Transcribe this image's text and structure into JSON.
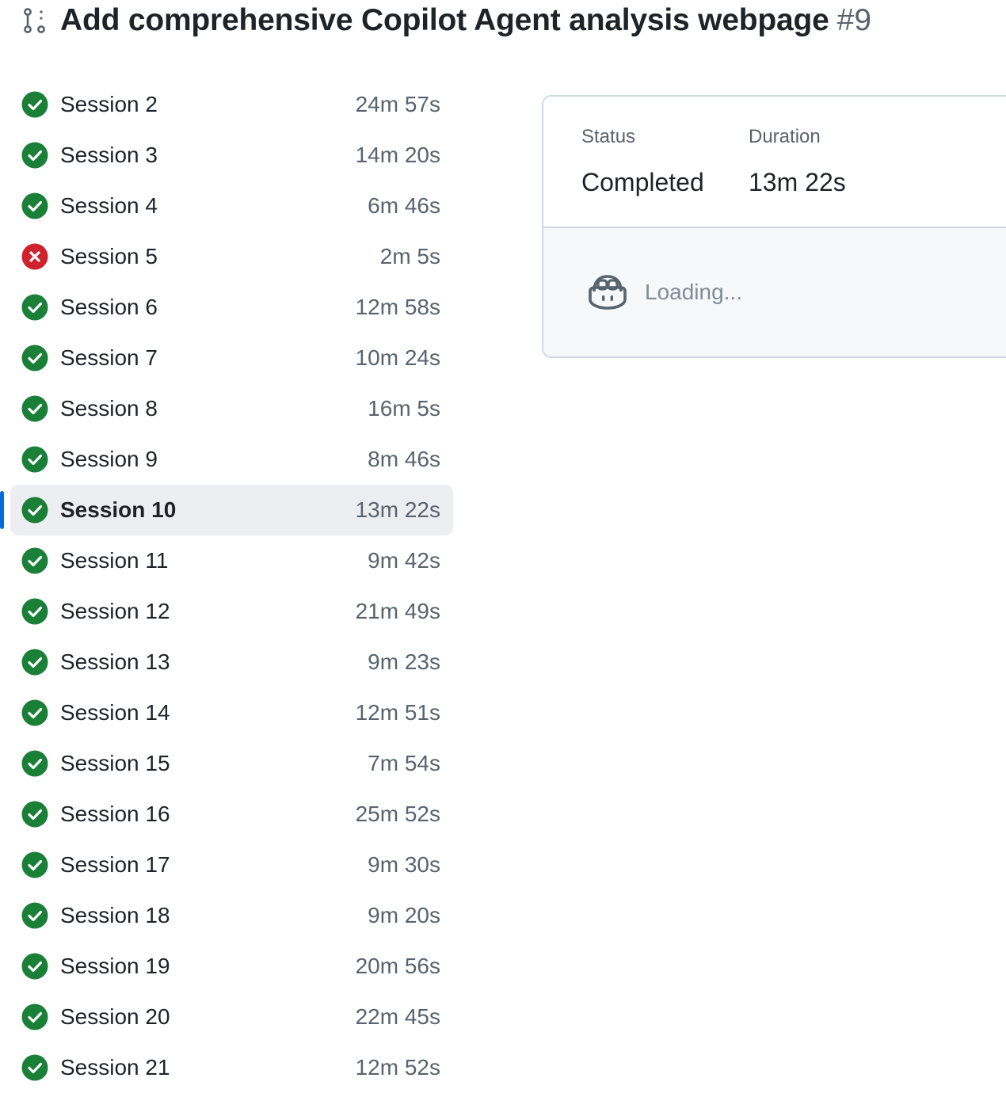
{
  "header": {
    "title": "Add comprehensive Copilot Agent analysis webpage",
    "number": "#9",
    "icon": "pull-request-icon"
  },
  "colors": {
    "success": "#1a7f37",
    "failure": "#cf222e",
    "selected_accent": "#0969da"
  },
  "sessions": [
    {
      "label": "Session 2",
      "duration": "24m 57s",
      "status": "success"
    },
    {
      "label": "Session 3",
      "duration": "14m 20s",
      "status": "success"
    },
    {
      "label": "Session 4",
      "duration": "6m 46s",
      "status": "success"
    },
    {
      "label": "Session 5",
      "duration": "2m 5s",
      "status": "failure"
    },
    {
      "label": "Session 6",
      "duration": "12m 58s",
      "status": "success"
    },
    {
      "label": "Session 7",
      "duration": "10m 24s",
      "status": "success"
    },
    {
      "label": "Session 8",
      "duration": "16m 5s",
      "status": "success"
    },
    {
      "label": "Session 9",
      "duration": "8m 46s",
      "status": "success"
    },
    {
      "label": "Session 10",
      "duration": "13m 22s",
      "status": "success",
      "selected": true
    },
    {
      "label": "Session 11",
      "duration": "9m 42s",
      "status": "success"
    },
    {
      "label": "Session 12",
      "duration": "21m 49s",
      "status": "success"
    },
    {
      "label": "Session 13",
      "duration": "9m 23s",
      "status": "success"
    },
    {
      "label": "Session 14",
      "duration": "12m 51s",
      "status": "success"
    },
    {
      "label": "Session 15",
      "duration": "7m 54s",
      "status": "success"
    },
    {
      "label": "Session 16",
      "duration": "25m 52s",
      "status": "success"
    },
    {
      "label": "Session 17",
      "duration": "9m 30s",
      "status": "success"
    },
    {
      "label": "Session 18",
      "duration": "9m 20s",
      "status": "success"
    },
    {
      "label": "Session 19",
      "duration": "20m 56s",
      "status": "success"
    },
    {
      "label": "Session 20",
      "duration": "22m 45s",
      "status": "success"
    },
    {
      "label": "Session 21",
      "duration": "12m 52s",
      "status": "success"
    }
  ],
  "detail": {
    "status_label": "Status",
    "status_value": "Completed",
    "duration_label": "Duration",
    "duration_value": "13m 22s",
    "loading_text": "Loading...",
    "loading_icon": "copilot-icon"
  }
}
